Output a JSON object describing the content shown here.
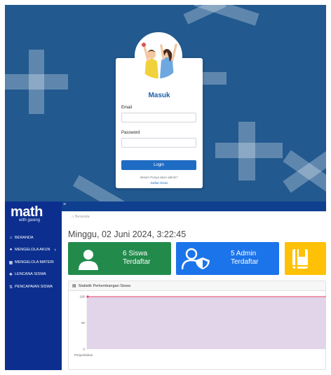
{
  "login": {
    "title": "Masuk",
    "email_label": "Email",
    "email_value": "",
    "password_label": "Password",
    "password_value": "",
    "button_label": "Login",
    "signup_prompt": "Belum Punya akun admin?",
    "signup_link": "Daftar Disini",
    "colors": {
      "background": "#22598f",
      "accent": "#1f6cc4"
    }
  },
  "sidebar": {
    "brand_name": "math",
    "brand_tagline": "with gasing",
    "items": [
      {
        "label": "BERANDA",
        "icon": "home-icon"
      },
      {
        "label": "MENGELOLA AKUN",
        "icon": "users-icon",
        "has_chevron": true
      },
      {
        "label": "MENGELOLA MATERI",
        "icon": "book-icon"
      },
      {
        "label": "LENCANA SISWA",
        "icon": "badge-icon"
      },
      {
        "label": "PENCAPAIAN SISWA",
        "icon": "chart-icon"
      }
    ]
  },
  "topbar": {
    "menu_icon": "hamburger-icon"
  },
  "main": {
    "breadcrumb": "Beranda",
    "datetime": "Minggu, 02 Juni 2024,  3:22:45",
    "cards": [
      {
        "text": "6 Siswa\nTerdaftar",
        "icon": "student-icon",
        "color": "#228b4c"
      },
      {
        "text": "5 Admin\nTerdaftar",
        "icon": "admin-shield-icon",
        "color": "#1c74ea"
      },
      {
        "text": "",
        "icon": "book-icon",
        "color": "#ffc107"
      }
    ],
    "panel_title": "Statistik Perkembangan Siswa"
  },
  "chart_data": {
    "type": "area",
    "title": "Statistik Perkembangan Siswa",
    "categories": [
      "Penjumlahan"
    ],
    "values": [
      100
    ],
    "yticks": [
      0,
      50,
      100
    ],
    "ylim": [
      0,
      100
    ],
    "fill_color": "#e2d5ea",
    "line_color": "#e8436b",
    "grid": false
  }
}
